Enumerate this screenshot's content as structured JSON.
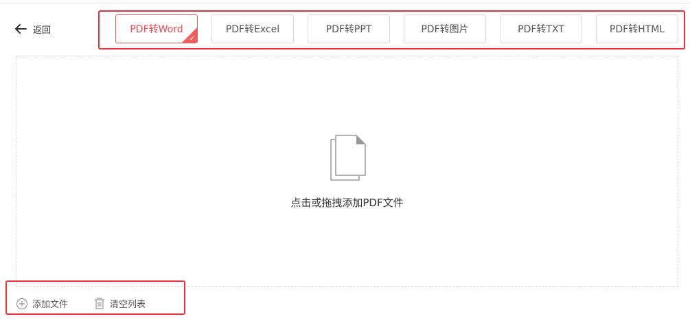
{
  "header": {
    "back_label": "返回"
  },
  "tabs": [
    {
      "label": "PDF转Word",
      "active": true
    },
    {
      "label": "PDF转Excel",
      "active": false
    },
    {
      "label": "PDF转PPT",
      "active": false
    },
    {
      "label": "PDF转图片",
      "active": false
    },
    {
      "label": "PDF转TXT",
      "active": false
    },
    {
      "label": "PDF转HTML",
      "active": false
    }
  ],
  "dropzone": {
    "icon": "document-stack-icon",
    "prompt": "点击或拖拽添加PDF文件"
  },
  "actions": {
    "add_file": {
      "label": "添加文件",
      "icon": "plus-circle-icon"
    },
    "clear_list": {
      "label": "清空列表",
      "icon": "trash-icon"
    }
  },
  "colors": {
    "accent": "#f0484e",
    "highlight_border": "#e8313a"
  }
}
